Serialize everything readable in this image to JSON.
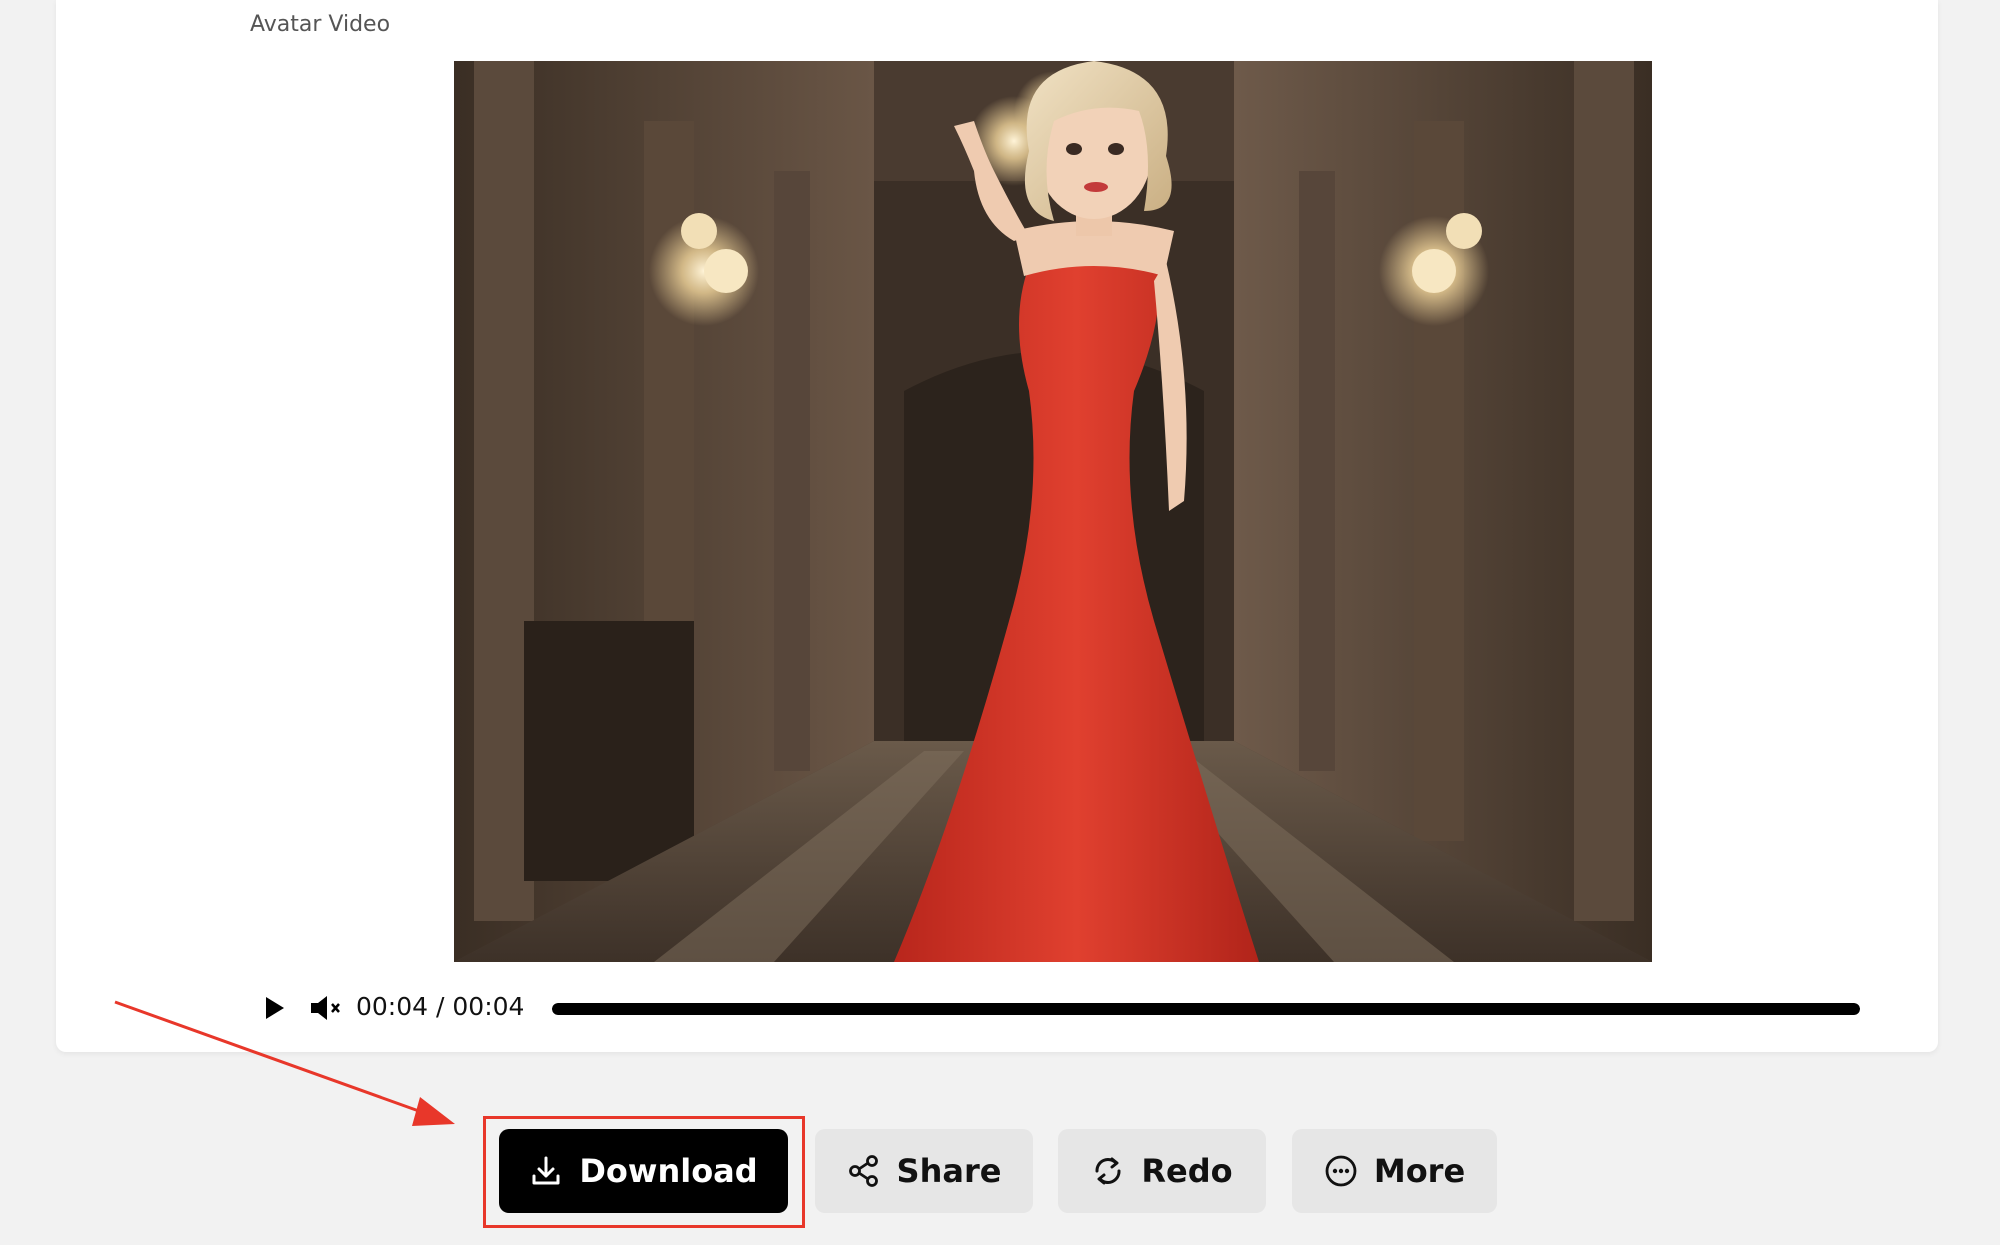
{
  "card": {
    "title": "Avatar Video"
  },
  "player": {
    "play_icon": "play-icon",
    "mute_icon": "volume-muted-icon",
    "current_time": "00:04",
    "separator": "/",
    "duration": "00:04",
    "progress_fraction": 1.0
  },
  "actions": {
    "download_label": "Download",
    "share_label": "Share",
    "redo_label": "Redo",
    "more_label": "More",
    "download_icon": "download-icon",
    "share_icon": "share-icon",
    "redo_icon": "refresh-icon",
    "more_icon": "more-dots-icon"
  },
  "annotation": {
    "color": "#e8372a"
  },
  "colors": {
    "primary_button": "#000000",
    "secondary_button": "#e6e6e6",
    "page_background": "#f2f2f2"
  }
}
